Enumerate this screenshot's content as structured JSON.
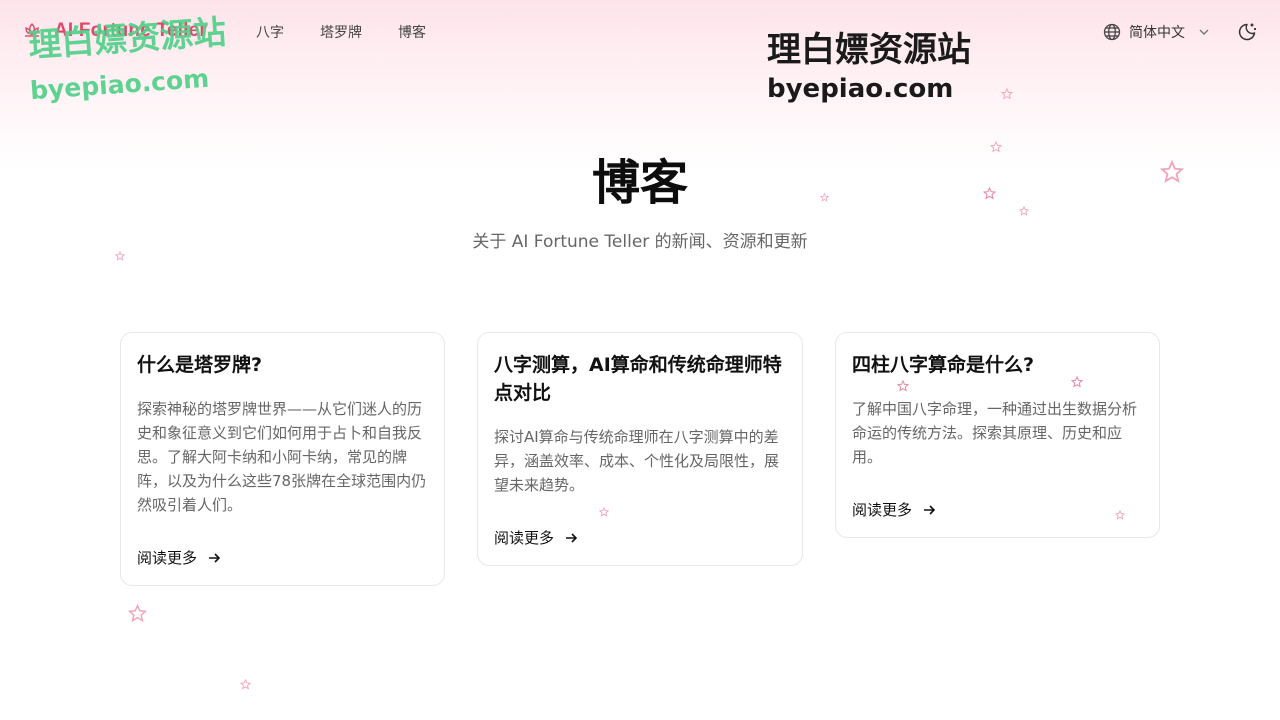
{
  "header": {
    "logo_text": "AI Fortune Teller",
    "nav": [
      "八字",
      "塔罗牌",
      "博客"
    ],
    "language": "简体中文"
  },
  "watermark": {
    "line1": "理白嫖资源站",
    "line2": "byepiao.com"
  },
  "hero": {
    "title": "博客",
    "subtitle": "关于 AI Fortune Teller 的新闻、资源和更新"
  },
  "posts": [
    {
      "title": "什么是塔罗牌?",
      "excerpt": "探索神秘的塔罗牌世界——从它们迷人的历史和象征意义到它们如何用于占卜和自我反思。了解大阿卡纳和小阿卡纳，常见的牌阵，以及为什么这些78张牌在全球范围内仍然吸引着人们。",
      "read_more": "阅读更多"
    },
    {
      "title": "八字测算，AI算命和传统命理师特点对比",
      "excerpt": "探讨AI算命与传统命理师在八字测算中的差异，涵盖效率、成本、个性化及局限性，展望未来趋势。",
      "read_more": "阅读更多"
    },
    {
      "title": "四柱八字算命是什么?",
      "excerpt": "了解中国八字命理，一种通过出生数据分析命运的传统方法。探索其原理、历史和应用。",
      "read_more": "阅读更多"
    }
  ],
  "colors": {
    "brand": "#e0466a",
    "star": "#f2a3b8",
    "watermark_green": "#52d08a"
  },
  "icons": {
    "logo": "lotus-icon",
    "language": "globe-icon",
    "chevron": "chevron-down-icon",
    "theme": "moon-stars-icon",
    "arrow": "arrow-right-icon",
    "decoration": "star-icon"
  }
}
